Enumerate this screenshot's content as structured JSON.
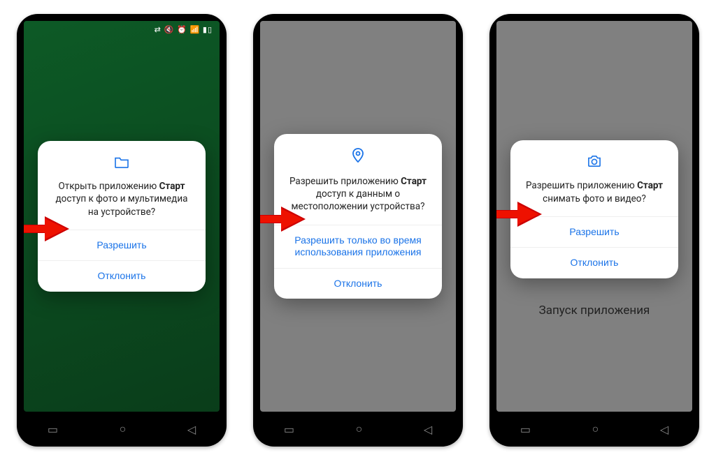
{
  "phone1": {
    "bg": "green",
    "statusbar": {
      "show": true,
      "icons": "⇄ 🔇 ⏰ 📶 ▮▯"
    },
    "dialog": {
      "icon": "folder",
      "msg_pre": "Открыть приложению ",
      "msg_bold": "Старт",
      "msg_post": " доступ к фото и мультимедиа на устройстве?",
      "btn1": "Разрешить",
      "btn2": "Отклонить"
    },
    "arrow_top": "350"
  },
  "phone2": {
    "bg": "grey",
    "dialog": {
      "icon": "location",
      "msg_pre": "Разрешить приложению ",
      "msg_bold": "Старт",
      "msg_post": " доступ к данным о местоположении устройства?",
      "btn1": "Разрешить только во время использования приложения",
      "btn2": "Отклонить"
    },
    "arrow_top": "332"
  },
  "phone3": {
    "bg": "grey",
    "dialog": {
      "icon": "camera",
      "msg_pre": "Разрешить приложению ",
      "msg_bold": "Старт",
      "msg_post": " снимать фото и видео?",
      "btn1": "Разрешить",
      "btn2": "Отклонить"
    },
    "arrow_top": "325",
    "launch_text": "Запуск приложения"
  }
}
